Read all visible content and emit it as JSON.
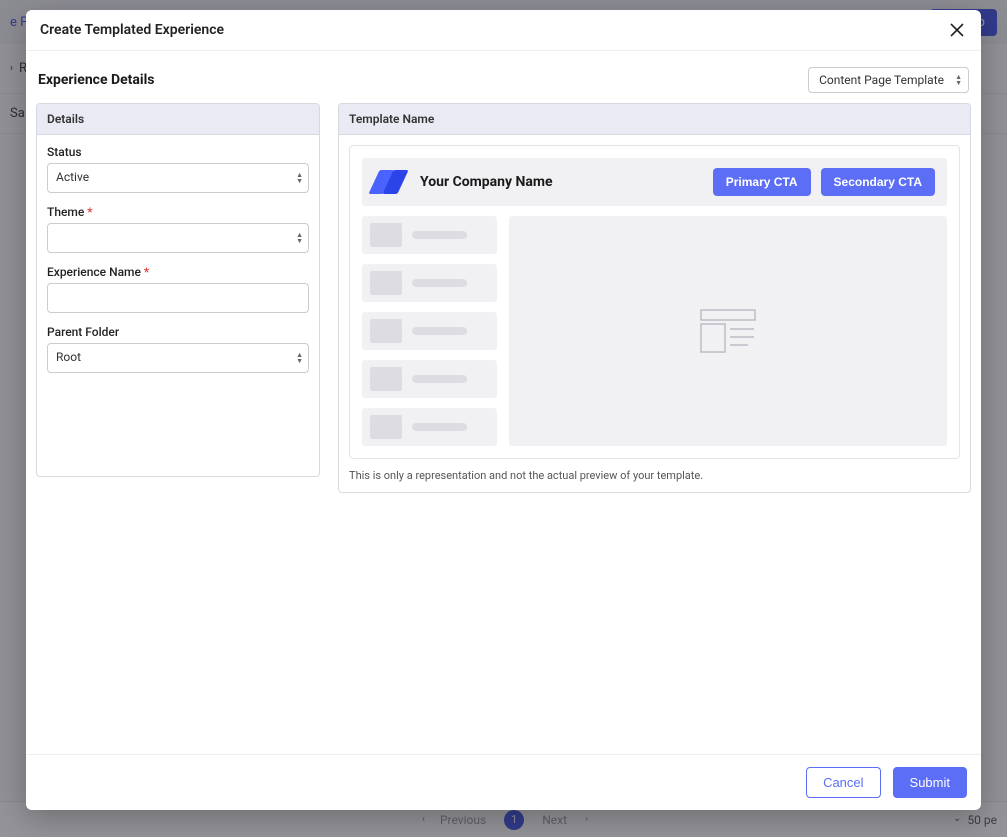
{
  "background": {
    "topbar": {
      "folder_link_partial": "e Fol",
      "create_btn_partial": "ate Exp"
    },
    "breadcrumb_partial": "R",
    "tab_partial": "Sa",
    "pagination": {
      "previous": "Previous",
      "page": "1",
      "next": "Next",
      "perpage_partial": "50 pe"
    }
  },
  "modal": {
    "title": "Create Templated Experience",
    "section_title": "Experience Details",
    "template_select": "Content Page Template",
    "details": {
      "header": "Details",
      "status_label": "Status",
      "status_value": "Active",
      "theme_label": "Theme",
      "theme_value": "",
      "name_label": "Experience Name",
      "name_value": "",
      "folder_label": "Parent Folder",
      "folder_value": "Root"
    },
    "template": {
      "header": "Template Name",
      "company": "Your Company Name",
      "primary_cta": "Primary CTA",
      "secondary_cta": "Secondary CTA",
      "disclaimer": "This is only a representation and not the actual preview of your template."
    },
    "footer": {
      "cancel": "Cancel",
      "submit": "Submit"
    }
  }
}
